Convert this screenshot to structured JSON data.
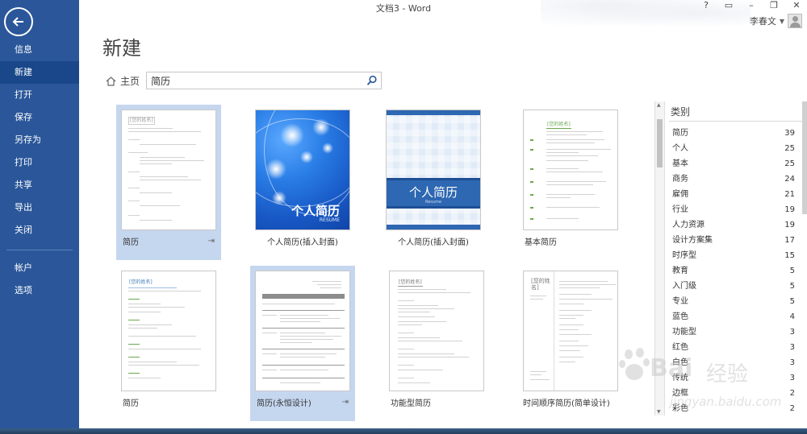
{
  "window": {
    "title": "文档3 - Word",
    "help": "?",
    "restore_ribbon": "▭",
    "minimize": "–",
    "maximize": "❐",
    "close": "✕"
  },
  "user": {
    "name": "李春文",
    "caret": "▼"
  },
  "sidebar": {
    "back_icon": "back-arrow-icon",
    "items": [
      {
        "label": "信息"
      },
      {
        "label": "新建"
      },
      {
        "label": "打开"
      },
      {
        "label": "保存"
      },
      {
        "label": "另存为"
      },
      {
        "label": "打印"
      },
      {
        "label": "共享"
      },
      {
        "label": "导出"
      },
      {
        "label": "关闭"
      },
      {
        "label": "帐户"
      },
      {
        "label": "选项"
      }
    ],
    "active": "新建"
  },
  "page": {
    "title": "新建"
  },
  "home": {
    "label": "主页",
    "icon": "home-icon"
  },
  "search": {
    "value": "简历",
    "icon": "search-icon"
  },
  "templates": [
    {
      "name": "简历",
      "pin": "⇥",
      "thumb_heading": "[您的姓名]"
    },
    {
      "name": "个人简历(插入封面)",
      "cover_title": "个人简历",
      "cover_sub": "RESUME"
    },
    {
      "name": "个人简历(插入封面)",
      "cover_title": "个人简历",
      "cover_sub": "Resume"
    },
    {
      "name": "基本简历",
      "thumb_heading": "[您的姓名]"
    },
    {
      "name": "简历",
      "thumb_heading": "[您的姓名]"
    },
    {
      "name": "简历(永恒设计)",
      "pin": "⇥"
    },
    {
      "name": "功能型简历",
      "thumb_heading": "[您的姓名]"
    },
    {
      "name": "时间顺序简历(简单设计)",
      "thumb_heading": "[您的姓名]"
    }
  ],
  "categories": {
    "title": "类别",
    "items": [
      {
        "label": "简历",
        "count": "39"
      },
      {
        "label": "个人",
        "count": "25"
      },
      {
        "label": "基本",
        "count": "25"
      },
      {
        "label": "商务",
        "count": "24"
      },
      {
        "label": "雇佣",
        "count": "21"
      },
      {
        "label": "行业",
        "count": "19"
      },
      {
        "label": "人力资源",
        "count": "19"
      },
      {
        "label": "设计方案集",
        "count": "17"
      },
      {
        "label": "时序型",
        "count": "15"
      },
      {
        "label": "教育",
        "count": "5"
      },
      {
        "label": "入门级",
        "count": "5"
      },
      {
        "label": "专业",
        "count": "5"
      },
      {
        "label": "蓝色",
        "count": "4"
      },
      {
        "label": "功能型",
        "count": "3"
      },
      {
        "label": "红色",
        "count": "3"
      },
      {
        "label": "白色",
        "count": "3"
      },
      {
        "label": "传统",
        "count": "3"
      },
      {
        "label": "边框",
        "count": "2"
      },
      {
        "label": "彩色",
        "count": "2"
      }
    ]
  },
  "watermark": {
    "brand": "Bai",
    "cn": "经验",
    "url": "jingyan.baidu.com"
  },
  "colors": {
    "sidebar": "#2b579a",
    "sidebar_active": "#19478a",
    "selection": "#c5d6ef"
  }
}
